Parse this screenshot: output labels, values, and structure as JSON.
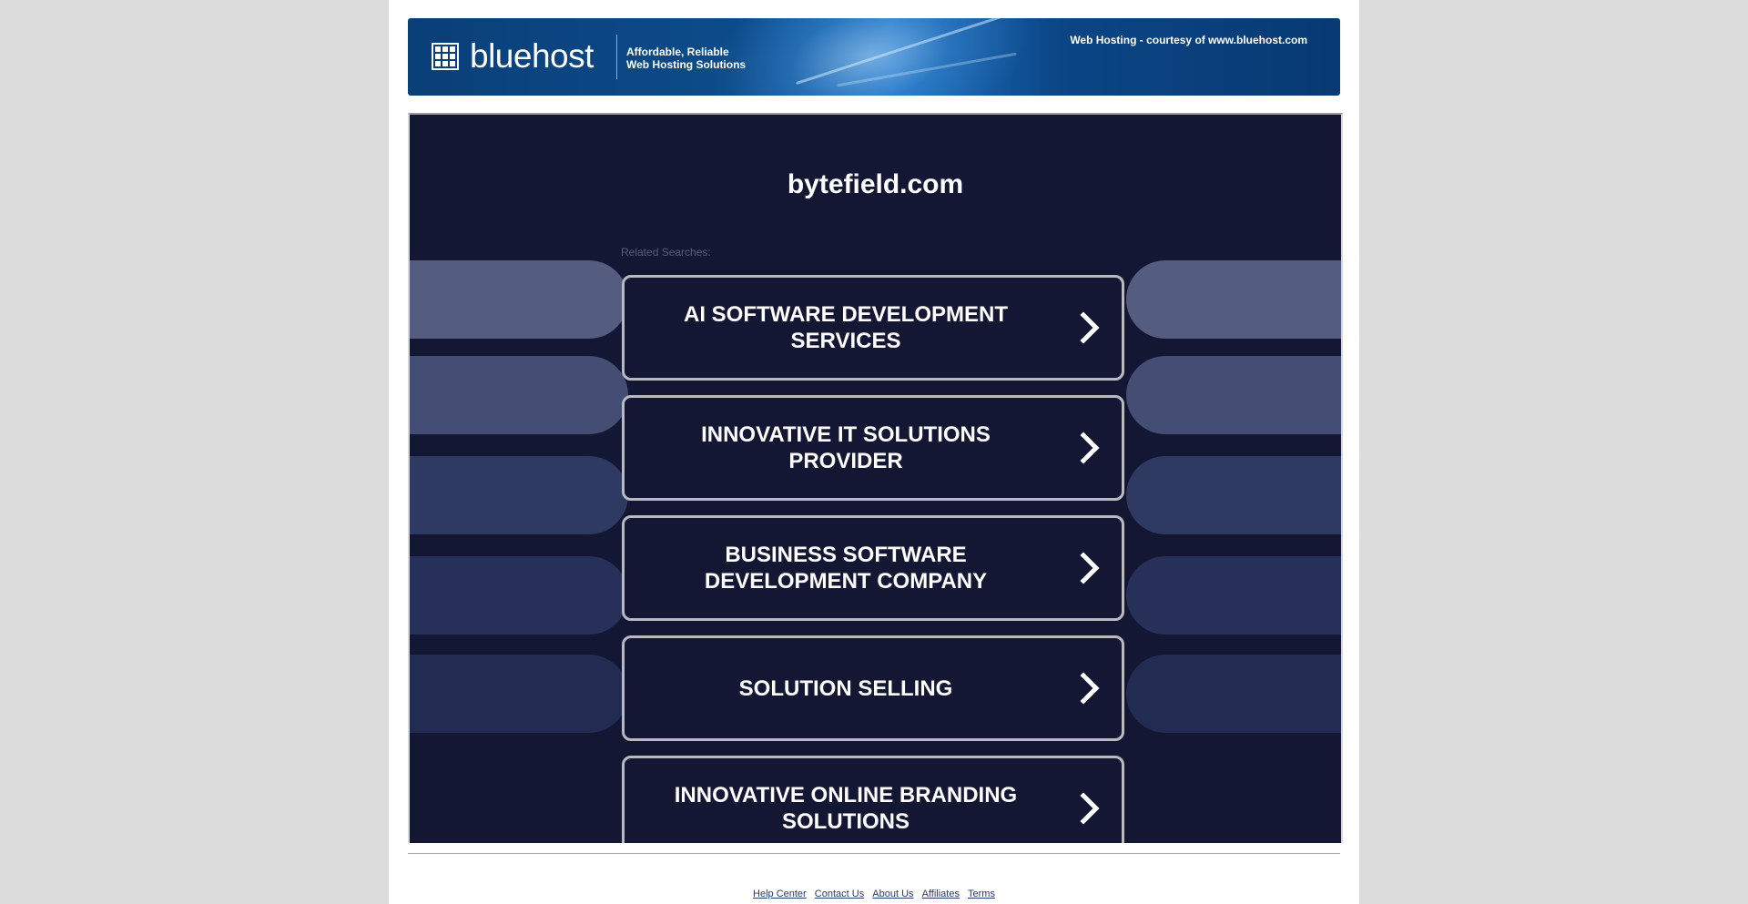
{
  "header": {
    "logo_text_light": "blue",
    "logo_text_bold": "host",
    "tagline_line1": "Affordable, Reliable",
    "tagline_line2": "Web Hosting Solutions",
    "courtesy": "Web Hosting - courtesy of www.bluehost.com"
  },
  "main": {
    "domain": "bytefield.com",
    "related_label": "Related Searches:",
    "links": [
      {
        "label": "AI SOFTWARE DEVELOPMENT SERVICES"
      },
      {
        "label": "INNOVATIVE IT SOLUTIONS PROVIDER"
      },
      {
        "label": "BUSINESS SOFTWARE DEVELOPMENT COMPANY"
      },
      {
        "label": "SOLUTION SELLING"
      },
      {
        "label": "INNOVATIVE ONLINE BRANDING SOLUTIONS"
      }
    ]
  },
  "footer": {
    "links": [
      {
        "label": "Help Center"
      },
      {
        "label": "Contact Us"
      },
      {
        "label": "About Us"
      },
      {
        "label": "Affiliates"
      },
      {
        "label": "Terms"
      }
    ]
  },
  "colors": {
    "page_bg": "#dcdcdc",
    "panel_bg": "#131733",
    "banner_blue": "#0c4b8a",
    "button_border": "#b9bac0",
    "footer_link": "#2a3a6a"
  }
}
